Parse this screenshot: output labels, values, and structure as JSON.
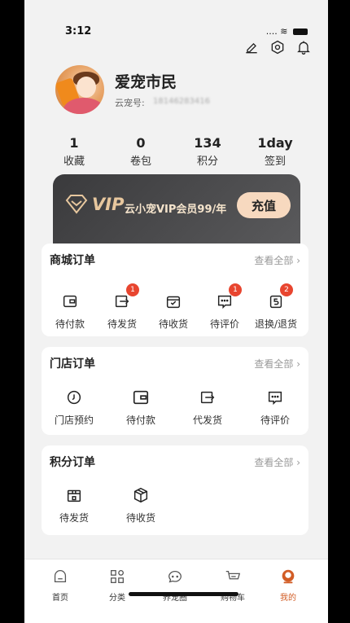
{
  "status_bar": {
    "time": "3:12",
    "signal": "....",
    "wifi": "≋"
  },
  "header": {
    "nickname": "爱宠市民",
    "uid_label": "云宠号:",
    "uid_value": "18146283416"
  },
  "stats": [
    {
      "value": "1",
      "label": "收藏"
    },
    {
      "value": "0",
      "label": "卷包"
    },
    {
      "value": "134",
      "label": "积分"
    },
    {
      "value": "1day",
      "label": "签到"
    }
  ],
  "vip": {
    "title": "VIP",
    "desc": "云小宠VIP会员99/年",
    "button": "充值"
  },
  "mall_orders": {
    "title": "商城订单",
    "more": "查看全部 ›",
    "items": [
      {
        "label": "待付款",
        "icon": "wallet-icon",
        "badge": ""
      },
      {
        "label": "待发货",
        "icon": "ship-icon",
        "badge": "1"
      },
      {
        "label": "待收货",
        "icon": "receive-icon",
        "badge": ""
      },
      {
        "label": "待评价",
        "icon": "comment-icon",
        "badge": "1"
      },
      {
        "label": "退换/退货",
        "icon": "refund-icon",
        "badge": "2"
      }
    ]
  },
  "store_orders": {
    "title": "门店订单",
    "more": "查看全部 ›",
    "items": [
      {
        "label": "门店预约",
        "icon": "clock-icon"
      },
      {
        "label": "待付款",
        "icon": "wallet-icon"
      },
      {
        "label": "代发货",
        "icon": "ship-icon"
      },
      {
        "label": "待评价",
        "icon": "comment-icon"
      }
    ]
  },
  "points_orders": {
    "title": "积分订单",
    "more": "查看全部 ›",
    "items": [
      {
        "label": "待发货",
        "icon": "gift-box-icon"
      },
      {
        "label": "待收货",
        "icon": "package-icon"
      }
    ]
  },
  "tabbar": [
    {
      "label": "首页",
      "icon": "home-icon"
    },
    {
      "label": "分类",
      "icon": "category-icon"
    },
    {
      "label": "养宠圈",
      "icon": "chat-icon"
    },
    {
      "label": "购物车",
      "icon": "cart-icon"
    },
    {
      "label": "我的",
      "icon": "profile-icon",
      "active": true
    }
  ],
  "colors": {
    "accent": "#d25d26",
    "badge": "#e8452f",
    "vip_gold": "#e7c79e"
  }
}
